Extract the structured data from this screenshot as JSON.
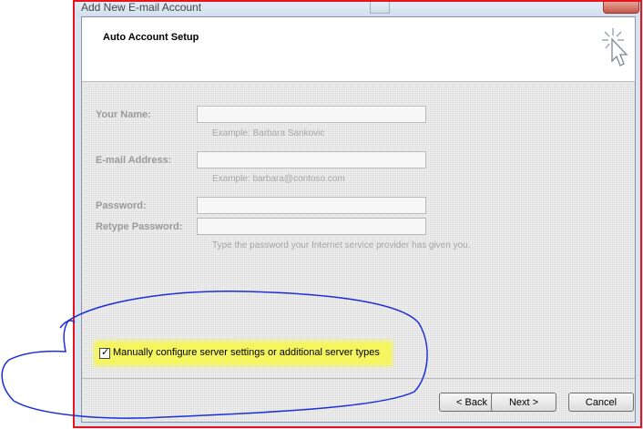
{
  "window": {
    "title": "Add New E-mail Account"
  },
  "header": {
    "title": "Auto Account Setup"
  },
  "form": {
    "your_name": {
      "label": "Your Name:",
      "value": "",
      "hint": "Example: Barbara Sankovic"
    },
    "email": {
      "label": "E-mail Address:",
      "value": "",
      "hint": "Example: barbara@contoso.com"
    },
    "password": {
      "label": "Password:",
      "value": ""
    },
    "retype_password": {
      "label": "Retype Password:",
      "value": "",
      "hint": "Type the password your Internet service provider has given you."
    }
  },
  "manual_config": {
    "label": "Manually configure server settings or additional server types",
    "checked": true,
    "check_glyph": "✓"
  },
  "buttons": {
    "back": "< Back",
    "next": "Next >",
    "cancel": "Cancel"
  },
  "colors": {
    "highlight": "#f5f55f",
    "annotation_red": "#e8141b",
    "annotation_blue": "#1c2fd9"
  },
  "icons": {
    "wizard": "sparkle-cursor-icon"
  }
}
